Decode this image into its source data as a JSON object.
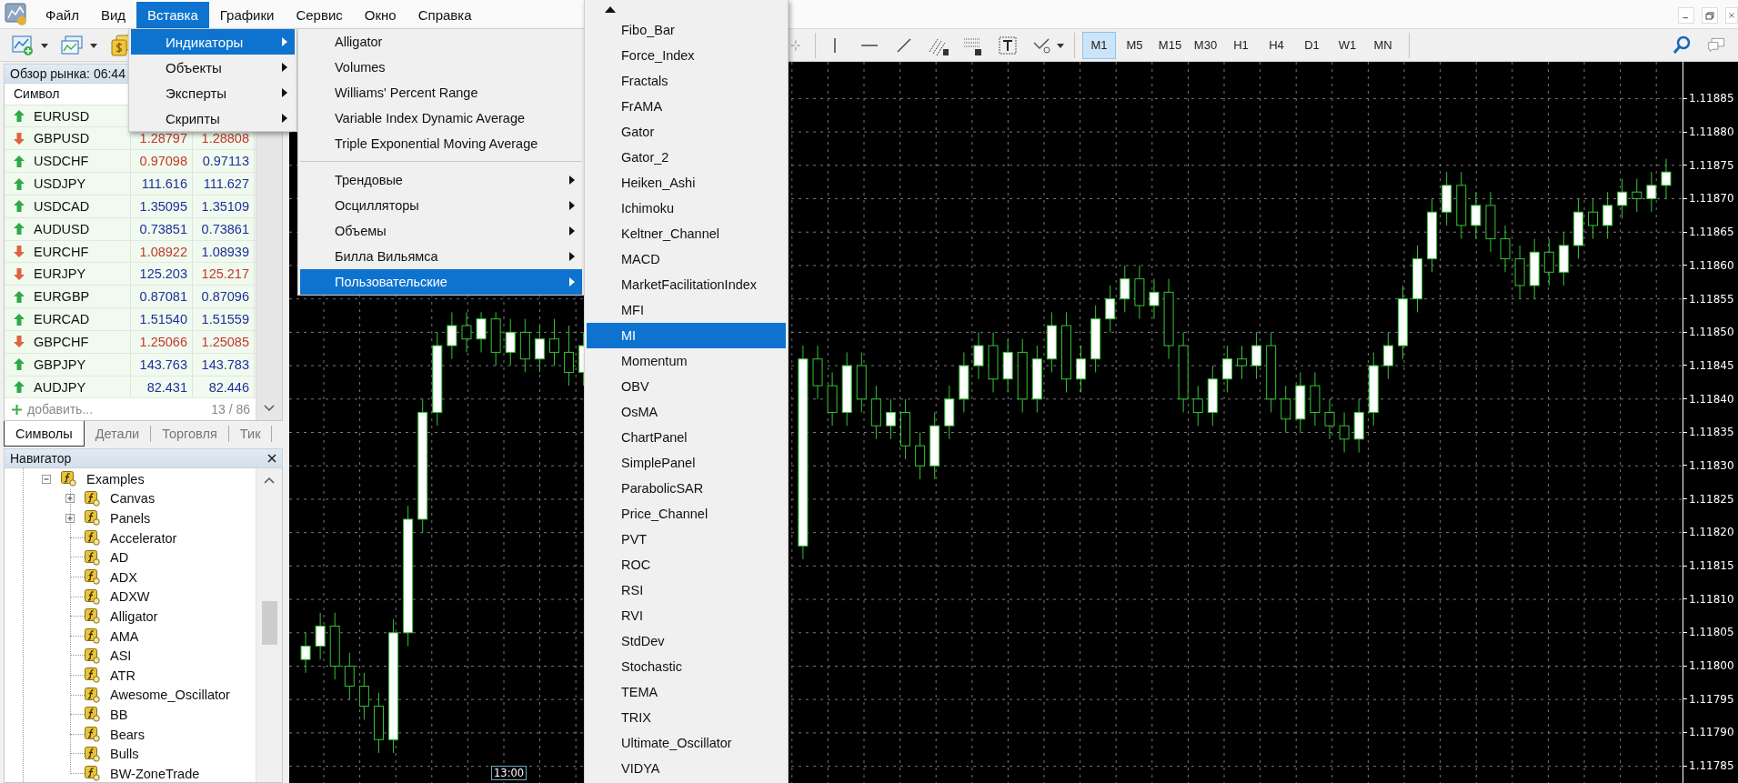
{
  "menu_bar": {
    "items": [
      {
        "label": "Файл",
        "selected": false
      },
      {
        "label": "Вид",
        "selected": false
      },
      {
        "label": "Вставка",
        "selected": true
      },
      {
        "label": "Графики",
        "selected": false
      },
      {
        "label": "Сервис",
        "selected": false
      },
      {
        "label": "Окно",
        "selected": false
      },
      {
        "label": "Справка",
        "selected": false
      }
    ]
  },
  "toolbar": {
    "timeframes": [
      {
        "label": "M1",
        "selected": true
      },
      {
        "label": "M5",
        "selected": false
      },
      {
        "label": "M15",
        "selected": false
      },
      {
        "label": "M30",
        "selected": false
      },
      {
        "label": "H1",
        "selected": false
      },
      {
        "label": "H4",
        "selected": false
      },
      {
        "label": "D1",
        "selected": false
      },
      {
        "label": "W1",
        "selected": false
      },
      {
        "label": "MN",
        "selected": false
      }
    ]
  },
  "market_watch": {
    "title": "Обзор рынка: 06:44",
    "symbol_column": "Символ",
    "rows": [
      {
        "symbol": "EURUSD",
        "rising": true
      },
      {
        "symbol": "GBPUSD",
        "rising": false,
        "bid": "1.28797",
        "bid_rising": false,
        "ask": "1.28808",
        "ask_rising": false
      },
      {
        "symbol": "USDCHF",
        "rising": true,
        "bid": "0.97098",
        "bid_rising": false,
        "ask": "0.97113",
        "ask_rising": true
      },
      {
        "symbol": "USDJPY",
        "rising": true,
        "bid": "111.616",
        "bid_rising": true,
        "ask": "111.627",
        "ask_rising": true
      },
      {
        "symbol": "USDCAD",
        "rising": true,
        "bid": "1.35095",
        "bid_rising": true,
        "ask": "1.35109",
        "ask_rising": true
      },
      {
        "symbol": "AUDUSD",
        "rising": true,
        "bid": "0.73851",
        "bid_rising": true,
        "ask": "0.73861",
        "ask_rising": true
      },
      {
        "symbol": "EURCHF",
        "rising": false,
        "bid": "1.08922",
        "bid_rising": false,
        "ask": "1.08939",
        "ask_rising": true
      },
      {
        "symbol": "EURJPY",
        "rising": false,
        "bid": "125.203",
        "bid_rising": true,
        "ask": "125.217",
        "ask_rising": false
      },
      {
        "symbol": "EURGBP",
        "rising": true,
        "bid": "0.87081",
        "bid_rising": true,
        "ask": "0.87096",
        "ask_rising": true
      },
      {
        "symbol": "EURCAD",
        "rising": true,
        "bid": "1.51540",
        "bid_rising": true,
        "ask": "1.51559",
        "ask_rising": true
      },
      {
        "symbol": "GBPCHF",
        "rising": false,
        "bid": "1.25066",
        "bid_rising": false,
        "ask": "1.25085",
        "ask_rising": false
      },
      {
        "symbol": "GBPJPY",
        "rising": true,
        "bid": "143.763",
        "bid_rising": true,
        "ask": "143.783",
        "ask_rising": true
      },
      {
        "symbol": "AUDJPY",
        "rising": true,
        "bid": "82.431",
        "bid_rising": true,
        "ask": "82.446",
        "ask_rising": true
      }
    ],
    "add_label": "добавить...",
    "count": "13 / 86",
    "tabs": [
      {
        "label": "Символы",
        "selected": true
      },
      {
        "label": "Детали",
        "selected": false
      },
      {
        "label": "Торговля",
        "selected": false
      },
      {
        "label": "Тик",
        "selected": false
      }
    ]
  },
  "navigator": {
    "title": "Навигатор",
    "tree": [
      {
        "label": "Examples",
        "expanded": true,
        "children": [
          {
            "label": "Canvas",
            "expanded": false
          },
          {
            "label": "Panels",
            "expanded": false
          },
          {
            "label": "Accelerator"
          },
          {
            "label": "AD"
          },
          {
            "label": "ADX"
          },
          {
            "label": "ADXW"
          },
          {
            "label": "Alligator"
          },
          {
            "label": "AMA"
          },
          {
            "label": "ASI"
          },
          {
            "label": "ATR"
          },
          {
            "label": "Awesome_Oscillator"
          },
          {
            "label": "BB"
          },
          {
            "label": "Bears"
          },
          {
            "label": "Bulls"
          },
          {
            "label": "BW-ZoneTrade"
          }
        ]
      }
    ]
  },
  "insert_menu": {
    "items": [
      {
        "label": "Индикаторы",
        "selected": true
      },
      {
        "label": "Объекты",
        "selected": false
      },
      {
        "label": "Эксперты",
        "selected": false
      },
      {
        "label": "Скрипты",
        "selected": false
      }
    ]
  },
  "indicators_menu": {
    "items": [
      {
        "label": "Alligator",
        "selected": false
      },
      {
        "label": "Volumes",
        "selected": false
      },
      {
        "label": "Williams' Percent Range",
        "selected": false
      },
      {
        "label": "Variable Index Dynamic Average",
        "selected": false
      },
      {
        "label": "Triple Exponential Moving Average",
        "selected": false
      }
    ],
    "categories": [
      {
        "label": "Трендовые",
        "selected": false
      },
      {
        "label": "Осцилляторы",
        "selected": false
      },
      {
        "label": "Объемы",
        "selected": false
      },
      {
        "label": "Билла Вильямса",
        "selected": false
      },
      {
        "label": "Пользовательские",
        "selected": true
      }
    ]
  },
  "custom_menu": {
    "items": [
      {
        "label": "Fibo_Bar",
        "selected": false
      },
      {
        "label": "Force_Index",
        "selected": false
      },
      {
        "label": "Fractals",
        "selected": false
      },
      {
        "label": "FrAMA",
        "selected": false
      },
      {
        "label": "Gator",
        "selected": false
      },
      {
        "label": "Gator_2",
        "selected": false
      },
      {
        "label": "Heiken_Ashi",
        "selected": false
      },
      {
        "label": "Ichimoku",
        "selected": false
      },
      {
        "label": "Keltner_Channel",
        "selected": false
      },
      {
        "label": "MACD",
        "selected": false
      },
      {
        "label": "MarketFacilitationIndex",
        "selected": false
      },
      {
        "label": "MFI",
        "selected": false
      },
      {
        "label": "MI",
        "selected": true
      },
      {
        "label": "Momentum",
        "selected": false
      },
      {
        "label": "OBV",
        "selected": false
      },
      {
        "label": "OsMA",
        "selected": false
      },
      {
        "label": "ChartPanel",
        "selected": false
      },
      {
        "label": "SimplePanel",
        "selected": false
      },
      {
        "label": "ParabolicSAR",
        "selected": false
      },
      {
        "label": "Price_Channel",
        "selected": false
      },
      {
        "label": "PVT",
        "selected": false
      },
      {
        "label": "ROC",
        "selected": false
      },
      {
        "label": "RSI",
        "selected": false
      },
      {
        "label": "RVI",
        "selected": false
      },
      {
        "label": "StdDev",
        "selected": false
      },
      {
        "label": "Stochastic",
        "selected": false
      },
      {
        "label": "TEMA",
        "selected": false
      },
      {
        "label": "TRIX",
        "selected": false
      },
      {
        "label": "Ultimate_Oscillator",
        "selected": false
      },
      {
        "label": "VIDYA",
        "selected": false
      }
    ]
  },
  "chart": {
    "time_label": "13:00",
    "chart_data": {
      "type": "candlestick",
      "grid": true,
      "categories": [
        null,
        null,
        null,
        null,
        null,
        null,
        null,
        null,
        null,
        null,
        null,
        null,
        null,
        null,
        null,
        null,
        null,
        null,
        null,
        null,
        null,
        null,
        null,
        null,
        null,
        null,
        null,
        null,
        null,
        null,
        null,
        null,
        null,
        null,
        null,
        null,
        null,
        null,
        null,
        null,
        null,
        null,
        null,
        null,
        null,
        null,
        null,
        null,
        null,
        null,
        null,
        null,
        null,
        null,
        null,
        null,
        null,
        null,
        null,
        null,
        null,
        null,
        null,
        null,
        null,
        null,
        null,
        null,
        null,
        null,
        null,
        null,
        null,
        null,
        null,
        null,
        null,
        null,
        null,
        null,
        null,
        null,
        null,
        null,
        null,
        null,
        null,
        null,
        null,
        null,
        null,
        null,
        null,
        null
      ],
      "ylim": [
        1.117825,
        1.118905
      ],
      "yticks": [
        {
          "value": 1.11885,
          "label": "1.11885"
        },
        {
          "value": 1.1188,
          "label": "1.11880"
        },
        {
          "value": 1.11875,
          "label": "1.11875"
        },
        {
          "value": 1.1187,
          "label": "1.11870"
        },
        {
          "value": 1.11865,
          "label": "1.11865"
        },
        {
          "value": 1.1186,
          "label": "1.11860"
        },
        {
          "value": 1.11855,
          "label": "1.11855"
        },
        {
          "value": 1.1185,
          "label": "1.11850"
        },
        {
          "value": 1.11845,
          "label": "1.11845"
        },
        {
          "value": 1.1184,
          "label": "1.11840"
        },
        {
          "value": 1.11835,
          "label": "1.11835"
        },
        {
          "value": 1.1183,
          "label": "1.11830"
        },
        {
          "value": 1.11825,
          "label": "1.11825"
        },
        {
          "value": 1.1182,
          "label": "1.11820"
        },
        {
          "value": 1.11815,
          "label": "1.11815"
        },
        {
          "value": 1.1181,
          "label": "1.11810"
        },
        {
          "value": 1.11805,
          "label": "1.11805"
        },
        {
          "value": 1.118,
          "label": "1.11800"
        },
        {
          "value": 1.11795,
          "label": "1.11795"
        },
        {
          "value": 1.1179,
          "label": "1.11790"
        },
        {
          "value": 1.11785,
          "label": "1.11785"
        }
      ],
      "ohlc": [
        [
          1.11801,
          1.11805,
          1.11799,
          1.11803
        ],
        [
          1.11803,
          1.11808,
          1.11801,
          1.11806
        ],
        [
          1.11806,
          1.11808,
          1.11798,
          1.118
        ],
        [
          1.118,
          1.11802,
          1.11795,
          1.11797
        ],
        [
          1.11797,
          1.11799,
          1.11792,
          1.11794
        ],
        [
          1.11794,
          1.11796,
          1.11787,
          1.11789
        ],
        [
          1.11789,
          1.11807,
          1.11787,
          1.11805
        ],
        [
          1.11805,
          1.11824,
          1.11803,
          1.11822
        ],
        [
          1.11822,
          1.1184,
          1.1182,
          1.11838
        ],
        [
          1.11838,
          1.1185,
          1.11836,
          1.11848
        ],
        [
          1.11848,
          1.11853,
          1.11846,
          1.11851
        ],
        [
          1.11851,
          1.11853,
          1.11847,
          1.11849
        ],
        [
          1.11849,
          1.11853,
          1.11847,
          1.11852
        ],
        [
          1.11852,
          1.11853,
          1.11845,
          1.11847
        ],
        [
          1.11847,
          1.11852,
          1.11845,
          1.1185
        ],
        [
          1.1185,
          1.11852,
          1.11844,
          1.11846
        ],
        [
          1.11846,
          1.11851,
          1.11844,
          1.11849
        ],
        [
          1.11849,
          1.11852,
          1.11845,
          1.11847
        ],
        [
          1.11847,
          1.11851,
          1.11842,
          1.11844
        ],
        [
          1.11844,
          1.1185,
          1.11842,
          1.11848
        ],
        null,
        null,
        null,
        null,
        null,
        null,
        null,
        null,
        null,
        null,
        null,
        null,
        null,
        null,
        [
          1.11818,
          1.11848,
          1.11816,
          1.11846
        ],
        [
          1.11846,
          1.11848,
          1.1184,
          1.11842
        ],
        [
          1.11842,
          1.11844,
          1.11836,
          1.11838
        ],
        [
          1.11838,
          1.11847,
          1.11836,
          1.11845
        ],
        [
          1.11845,
          1.11847,
          1.11838,
          1.1184
        ],
        [
          1.1184,
          1.11842,
          1.11834,
          1.11836
        ],
        [
          1.11836,
          1.1184,
          1.11834,
          1.11838
        ],
        [
          1.11838,
          1.1184,
          1.11831,
          1.11833
        ],
        [
          1.11833,
          1.11835,
          1.11828,
          1.1183
        ],
        [
          1.1183,
          1.11838,
          1.11828,
          1.11836
        ],
        [
          1.11836,
          1.11842,
          1.11834,
          1.1184
        ],
        [
          1.1184,
          1.11847,
          1.11838,
          1.11845
        ],
        [
          1.11845,
          1.1185,
          1.11843,
          1.11848
        ],
        [
          1.11848,
          1.1185,
          1.11841,
          1.11843
        ],
        [
          1.11843,
          1.11849,
          1.11841,
          1.11847
        ],
        [
          1.11847,
          1.11849,
          1.11838,
          1.1184
        ],
        [
          1.1184,
          1.11848,
          1.11838,
          1.11846
        ],
        [
          1.11846,
          1.11853,
          1.11844,
          1.11851
        ],
        [
          1.11851,
          1.11853,
          1.11841,
          1.11843
        ],
        [
          1.11843,
          1.11848,
          1.11841,
          1.11846
        ],
        [
          1.11846,
          1.11854,
          1.11844,
          1.11852
        ],
        [
          1.11852,
          1.11857,
          1.1185,
          1.11855
        ],
        [
          1.11855,
          1.1186,
          1.11853,
          1.11858
        ],
        [
          1.11858,
          1.1186,
          1.11852,
          1.11854
        ],
        [
          1.11854,
          1.11858,
          1.11852,
          1.11856
        ],
        [
          1.11856,
          1.11858,
          1.11846,
          1.11848
        ],
        [
          1.11848,
          1.1185,
          1.11838,
          1.1184
        ],
        [
          1.1184,
          1.11842,
          1.11836,
          1.11838
        ],
        [
          1.11838,
          1.11845,
          1.11836,
          1.11843
        ],
        [
          1.11843,
          1.11848,
          1.11841,
          1.11846
        ],
        [
          1.11846,
          1.11848,
          1.11843,
          1.11845
        ],
        [
          1.11845,
          1.1185,
          1.11843,
          1.11848
        ],
        [
          1.11848,
          1.1185,
          1.11838,
          1.1184
        ],
        [
          1.1184,
          1.11842,
          1.11835,
          1.11837
        ],
        [
          1.11837,
          1.11844,
          1.11835,
          1.11842
        ],
        [
          1.11842,
          1.11844,
          1.11836,
          1.11838
        ],
        [
          1.11838,
          1.1184,
          1.11834,
          1.11836
        ],
        [
          1.11836,
          1.11838,
          1.11832,
          1.11834
        ],
        [
          1.11834,
          1.1184,
          1.11832,
          1.11838
        ],
        [
          1.11838,
          1.11847,
          1.11836,
          1.11845
        ],
        [
          1.11845,
          1.1185,
          1.11843,
          1.11848
        ],
        [
          1.11848,
          1.11857,
          1.11846,
          1.11855
        ],
        [
          1.11855,
          1.11863,
          1.11853,
          1.11861
        ],
        [
          1.11861,
          1.1187,
          1.11859,
          1.11868
        ],
        [
          1.11868,
          1.11874,
          1.11866,
          1.11872
        ],
        [
          1.11872,
          1.11874,
          1.11864,
          1.11866
        ],
        [
          1.11866,
          1.11871,
          1.11864,
          1.11869
        ],
        [
          1.11869,
          1.11871,
          1.11862,
          1.11864
        ],
        [
          1.11864,
          1.11866,
          1.11859,
          1.11861
        ],
        [
          1.11861,
          1.11863,
          1.11855,
          1.11857
        ],
        [
          1.11857,
          1.11864,
          1.11855,
          1.11862
        ],
        [
          1.11862,
          1.11864,
          1.11857,
          1.11859
        ],
        [
          1.11859,
          1.11865,
          1.11857,
          1.11863
        ],
        [
          1.11863,
          1.1187,
          1.11861,
          1.11868
        ],
        [
          1.11868,
          1.1187,
          1.11864,
          1.11866
        ],
        [
          1.11866,
          1.11871,
          1.11864,
          1.11869
        ],
        [
          1.11869,
          1.11873,
          1.11867,
          1.11871
        ],
        [
          1.11871,
          1.11873,
          1.11868,
          1.1187
        ],
        [
          1.1187,
          1.11874,
          1.11868,
          1.11872
        ],
        [
          1.11872,
          1.11876,
          1.1187,
          1.11874
        ]
      ]
    }
  }
}
